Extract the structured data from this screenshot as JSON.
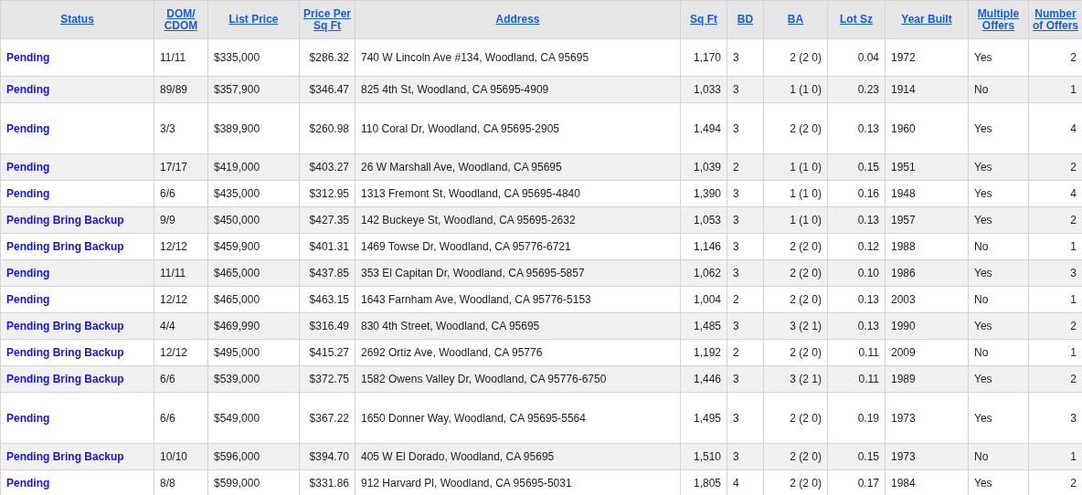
{
  "table": {
    "columns": [
      "Status",
      "DOM/ CDOM",
      "List Price",
      "Price Per Sq Ft",
      "Address",
      "Sq Ft",
      "BD",
      "BA",
      "Lot Sz",
      "Year Built",
      "Multiple Offers",
      "Number of Offers"
    ],
    "rows": [
      [
        "Pending",
        "11/11",
        "$335,000",
        "$286.32",
        "740 W Lincoln Ave #134, Woodland, CA 95695",
        "1,170",
        "3",
        "2 (2 0)",
        "0.04",
        "1972",
        "Yes",
        "2"
      ],
      [
        "Pending",
        "89/89",
        "$357,900",
        "$346.47",
        "825 4th St, Woodland, CA 95695-4909",
        "1,033",
        "3",
        "1 (1 0)",
        "0.23",
        "1914",
        "No",
        "1"
      ],
      [
        "Pending",
        "3/3",
        "$389,900",
        "$260.98",
        "110 Coral Dr, Woodland, CA 95695-2905",
        "1,494",
        "3",
        "2 (2 0)",
        "0.13",
        "1960",
        "Yes",
        "4"
      ],
      [
        "Pending",
        "17/17",
        "$419,000",
        "$403.27",
        "26 W Marshall Ave, Woodland, CA 95695",
        "1,039",
        "2",
        "1 (1 0)",
        "0.15",
        "1951",
        "Yes",
        "2"
      ],
      [
        "Pending",
        "6/6",
        "$435,000",
        "$312.95",
        "1313 Fremont St, Woodland, CA 95695-4840",
        "1,390",
        "3",
        "1 (1 0)",
        "0.16",
        "1948",
        "Yes",
        "4"
      ],
      [
        "Pending Bring Backup",
        "9/9",
        "$450,000",
        "$427.35",
        "142 Buckeye St, Woodland, CA 95695-2632",
        "1,053",
        "3",
        "1 (1 0)",
        "0.13",
        "1957",
        "Yes",
        "2"
      ],
      [
        "Pending Bring Backup",
        "12/12",
        "$459,900",
        "$401.31",
        "1469 Towse Dr, Woodland, CA 95776-6721",
        "1,146",
        "3",
        "2 (2 0)",
        "0.12",
        "1988",
        "No",
        "1"
      ],
      [
        "Pending",
        "11/11",
        "$465,000",
        "$437.85",
        "353 El Capitan Dr, Woodland, CA 95695-5857",
        "1,062",
        "3",
        "2 (2 0)",
        "0.10",
        "1986",
        "Yes",
        "3"
      ],
      [
        "Pending",
        "12/12",
        "$465,000",
        "$463.15",
        "1643 Farnham Ave, Woodland, CA 95776-5153",
        "1,004",
        "2",
        "2 (2 0)",
        "0.13",
        "2003",
        "No",
        "1"
      ],
      [
        "Pending Bring Backup",
        "4/4",
        "$469,990",
        "$316.49",
        "830 4th Street, Woodland, CA 95695",
        "1,485",
        "3",
        "3 (2 1)",
        "0.13",
        "1990",
        "Yes",
        "2"
      ],
      [
        "Pending Bring Backup",
        "12/12",
        "$495,000",
        "$415.27",
        "2692 Ortiz Ave, Woodland, CA 95776",
        "1,192",
        "2",
        "2 (2 0)",
        "0.11",
        "2009",
        "No",
        "1"
      ],
      [
        "Pending Bring Backup",
        "6/6",
        "$539,000",
        "$372.75",
        "1582 Owens Valley Dr, Woodland, CA 95776-6750",
        "1,446",
        "3",
        "3 (2 1)",
        "0.11",
        "1989",
        "Yes",
        "2"
      ],
      [
        "Pending",
        "6/6",
        "$549,000",
        "$367.22",
        "1650 Donner Way, Woodland, CA 95695-5564",
        "1,495",
        "3",
        "2 (2 0)",
        "0.19",
        "1973",
        "Yes",
        "3"
      ],
      [
        "Pending Bring Backup",
        "10/10",
        "$596,000",
        "$394.70",
        "405 W El Dorado, Woodland, CA 95695",
        "1,510",
        "3",
        "2 (2 0)",
        "0.15",
        "1973",
        "No",
        "1"
      ],
      [
        "Pending",
        "8/8",
        "$599,000",
        "$331.86",
        "912 Harvard Pl, Woodland, CA 95695-5031",
        "1,805",
        "4",
        "2 (2 0)",
        "0.17",
        "1984",
        "Yes",
        "2"
      ]
    ]
  }
}
